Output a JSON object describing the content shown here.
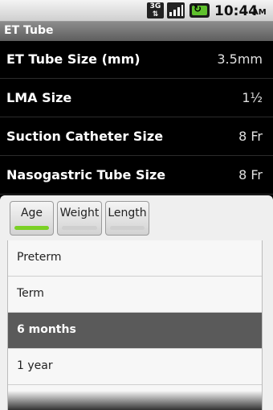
{
  "status_bar": {
    "network": "3G",
    "time": "10:44",
    "ampm": "AM"
  },
  "app": {
    "title": "ET Tube"
  },
  "sizes": [
    {
      "label": "ET Tube Size (mm)",
      "value": "3.5mm"
    },
    {
      "label": "LMA Size",
      "value": "1½"
    },
    {
      "label": "Suction Catheter Size",
      "value": "8 Fr"
    },
    {
      "label": "Nasogastric Tube Size",
      "value": "8 Fr"
    }
  ],
  "tabs": [
    {
      "label": "Age",
      "active": true
    },
    {
      "label": "Weight",
      "active": false
    },
    {
      "label": "Length",
      "active": false
    }
  ],
  "age_options": [
    {
      "label": "Preterm",
      "selected": false
    },
    {
      "label": "Term",
      "selected": false
    },
    {
      "label": "6 months",
      "selected": true
    },
    {
      "label": "1 year",
      "selected": false
    }
  ],
  "colors": {
    "accent_indicator": "#7bd025",
    "selected_row": "#5a5a5a"
  }
}
